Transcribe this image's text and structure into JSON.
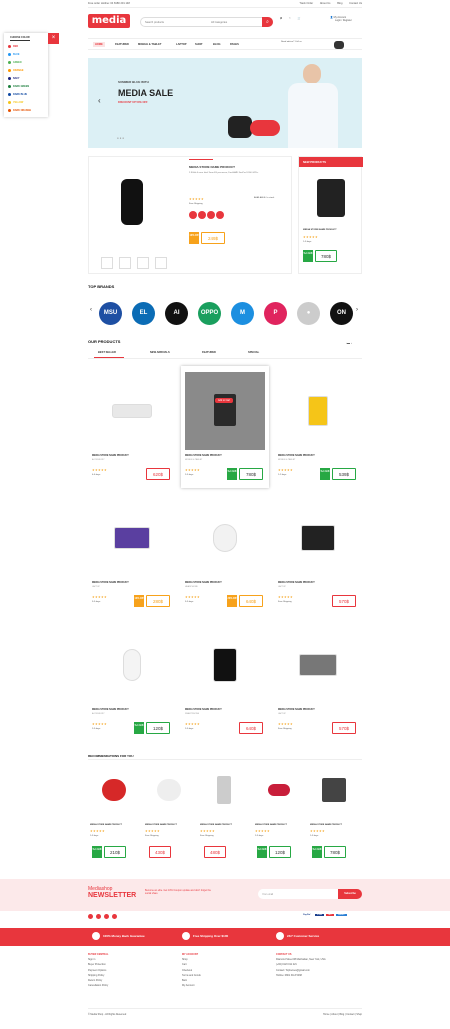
{
  "topbar": {
    "call": "Free order Hotline: 04 8180 201 148",
    "links": [
      "Track Order",
      "About Us",
      "Blog",
      "Contact Us"
    ]
  },
  "header": {
    "logo": "media",
    "search_placeholder": "Search products",
    "category": "All Categories",
    "account": "My Account",
    "account_sub": "Login / Register"
  },
  "nav": [
    "HOME",
    "FEATURED",
    "MOBILE & TABLET",
    "LAPTOP",
    "SHOP",
    "BLOG",
    "PAGES"
  ],
  "nav_promo": "Need advice? Call us",
  "color_panel": {
    "title": "CHOOSE COLOR",
    "options": [
      {
        "name": "RED",
        "color": "#e8363d"
      },
      {
        "name": "BLUE",
        "color": "#2196f3"
      },
      {
        "name": "GREEN",
        "color": "#4caf50"
      },
      {
        "name": "ORANGE",
        "color": "#ff9800"
      },
      {
        "name": "NAVY",
        "color": "#1a237e"
      },
      {
        "name": "DARK GREEN",
        "color": "#1b7e3c"
      },
      {
        "name": "DARK BLUE",
        "color": "#0d47a1"
      },
      {
        "name": "YELLOW",
        "color": "#f5c518"
      },
      {
        "name": "DARK ORANGE",
        "color": "#e65100"
      }
    ]
  },
  "banner": {
    "line1": "SUMMER BLUE WITH",
    "line2": "MEDIA SALE",
    "line3": "DISCOUNT UP 50% OFF"
  },
  "deal": {
    "title": "MEDIA STORE NAME PRODUCT",
    "desc": "2.9GHz 6-core Intel Xeon E5 processor, Dual AMD FirePro D300 GPUs",
    "free_shipping": "Free Shipping",
    "availability": "AVAILABLE: In stock",
    "discount": "10% Off",
    "price": "249$"
  },
  "new_products": {
    "header": "NEW PRODUCTS",
    "title": "MEDIA STORE NAME PRODUCT",
    "shipping": "1-3 days",
    "badge": "5+1 Gift",
    "price": "780$"
  },
  "brands_title": "TOP BRANDS",
  "brands": [
    {
      "name": "MSU",
      "bg": "#1e4fa3"
    },
    {
      "name": "EL",
      "bg": "#0b6cb5"
    },
    {
      "name": "AI",
      "bg": "#111111"
    },
    {
      "name": "OPPO",
      "bg": "#1a9f5e"
    },
    {
      "name": "M",
      "bg": "#1c8fe0"
    },
    {
      "name": "P",
      "bg": "#e0245e"
    },
    {
      "name": "●",
      "bg": "#cccccc"
    },
    {
      "name": "ON",
      "bg": "#111111"
    }
  ],
  "our_products": {
    "title": "OUR PRODUCTS",
    "tabs": [
      "BEST SELLER",
      "NEW ARRIVALS",
      "FEATURED",
      "SPECIAL"
    ],
    "items": [
      {
        "title": "MEDIA STORE NAME PRODUCT",
        "cat": "ACCESSORY",
        "ship": "4-6 days",
        "price": "620$",
        "badge": ""
      },
      {
        "title": "MEDIA STORE NAME PRODUCT",
        "cat": "MOBILE & TABLET",
        "ship": "2-5 days",
        "price": "780$",
        "badge": "5+1 Gift",
        "hover": "Add to Cart"
      },
      {
        "title": "MEDIA STORE NAME PRODUCT",
        "cat": "MOBILE & TABLET",
        "ship": "1-2 days",
        "price": "539$",
        "badge": "5+1 Gift"
      },
      {
        "title": "MEDIA STORE NAME PRODUCT",
        "cat": "LAPTOP",
        "ship": "3-5 days",
        "price": "280$",
        "badge": "10% Off"
      },
      {
        "title": "MEDIA STORE NAME PRODUCT",
        "cat": "HEADPHONE",
        "ship": "3-5 days",
        "price": "640$",
        "badge": "20% Off"
      },
      {
        "title": "MEDIA STORE NAME PRODUCT",
        "cat": "LAPTOP",
        "ship": "Free Shipping",
        "price": "570$",
        "badge": ""
      },
      {
        "title": "MEDIA STORE NAME PRODUCT",
        "cat": "ACCESSORY",
        "ship": "2-5 days",
        "price": "120$",
        "badge": "5+1 Gift"
      },
      {
        "title": "MEDIA STORE NAME PRODUCT",
        "cat": "SMARTPHONE",
        "ship": "2-5 days",
        "price": "640$",
        "badge": ""
      },
      {
        "title": "MEDIA STORE NAME PRODUCT",
        "cat": "LAPTOP",
        "ship": "Free Shipping",
        "price": "570$",
        "badge": ""
      }
    ]
  },
  "recommend": {
    "title": "RECOMMENDATIONS FOR YOU",
    "items": [
      {
        "title": "MEDIA STORE NAME PRODUCT",
        "ship": "1-3 days",
        "price": "210$",
        "badge": "5+1 Gift"
      },
      {
        "title": "MEDIA STORE NAME PRODUCT",
        "ship": "Free Shipping",
        "price": "430$",
        "badge": ""
      },
      {
        "title": "MEDIA STORE NAME PRODUCT",
        "ship": "Free Shipping",
        "price": "480$",
        "badge": ""
      },
      {
        "title": "MEDIA STORE NAME PRODUCT",
        "ship": "2-5 days",
        "price": "120$",
        "badge": "5+1 Gift"
      },
      {
        "title": "MEDIA STORE NAME PRODUCT",
        "ship": "1-3 days",
        "price": "780$",
        "badge": "5+1 Gift"
      }
    ]
  },
  "newsletter": {
    "brand": "Mediashop",
    "title": "NEWSLETTER",
    "text": "Become an elite. Get 10% Coupon update and don't forget the social share",
    "placeholder": "Your email",
    "button": "Subscribe"
  },
  "payments": [
    "PayPal",
    "VISA",
    "MC",
    "AMEX"
  ],
  "features": [
    "100% Money Back Guarantee",
    "Free Shipping Over $100",
    "24/7 Customer Service"
  ],
  "footer_cols": [
    {
      "head": "BUYER CENTRAL",
      "links": [
        "Sign in",
        "Buyer Protection",
        "Payment Options",
        "Shipping Policy",
        "Return Policy",
        "Cancellation Policy"
      ]
    },
    {
      "head": "MY ACCOUNT",
      "links": [
        "Shop",
        "Cart",
        "Checkout",
        "Terms and Conds",
        "Barn",
        "My Account"
      ]
    },
    {
      "head": "CONTACT US",
      "links": [
        "Diamond Street #8 Manhattan, New York, USA",
        "(+84) 0123 011 221",
        "Contact: Tophemes@gmail.com",
        "Hotline: 0801 3113 5468"
      ]
    }
  ],
  "copyright": "© Media Shop - All Rights Reserved",
  "bottom_links": [
    "Home",
    "About",
    "Blog",
    "Contact",
    "Shop"
  ]
}
